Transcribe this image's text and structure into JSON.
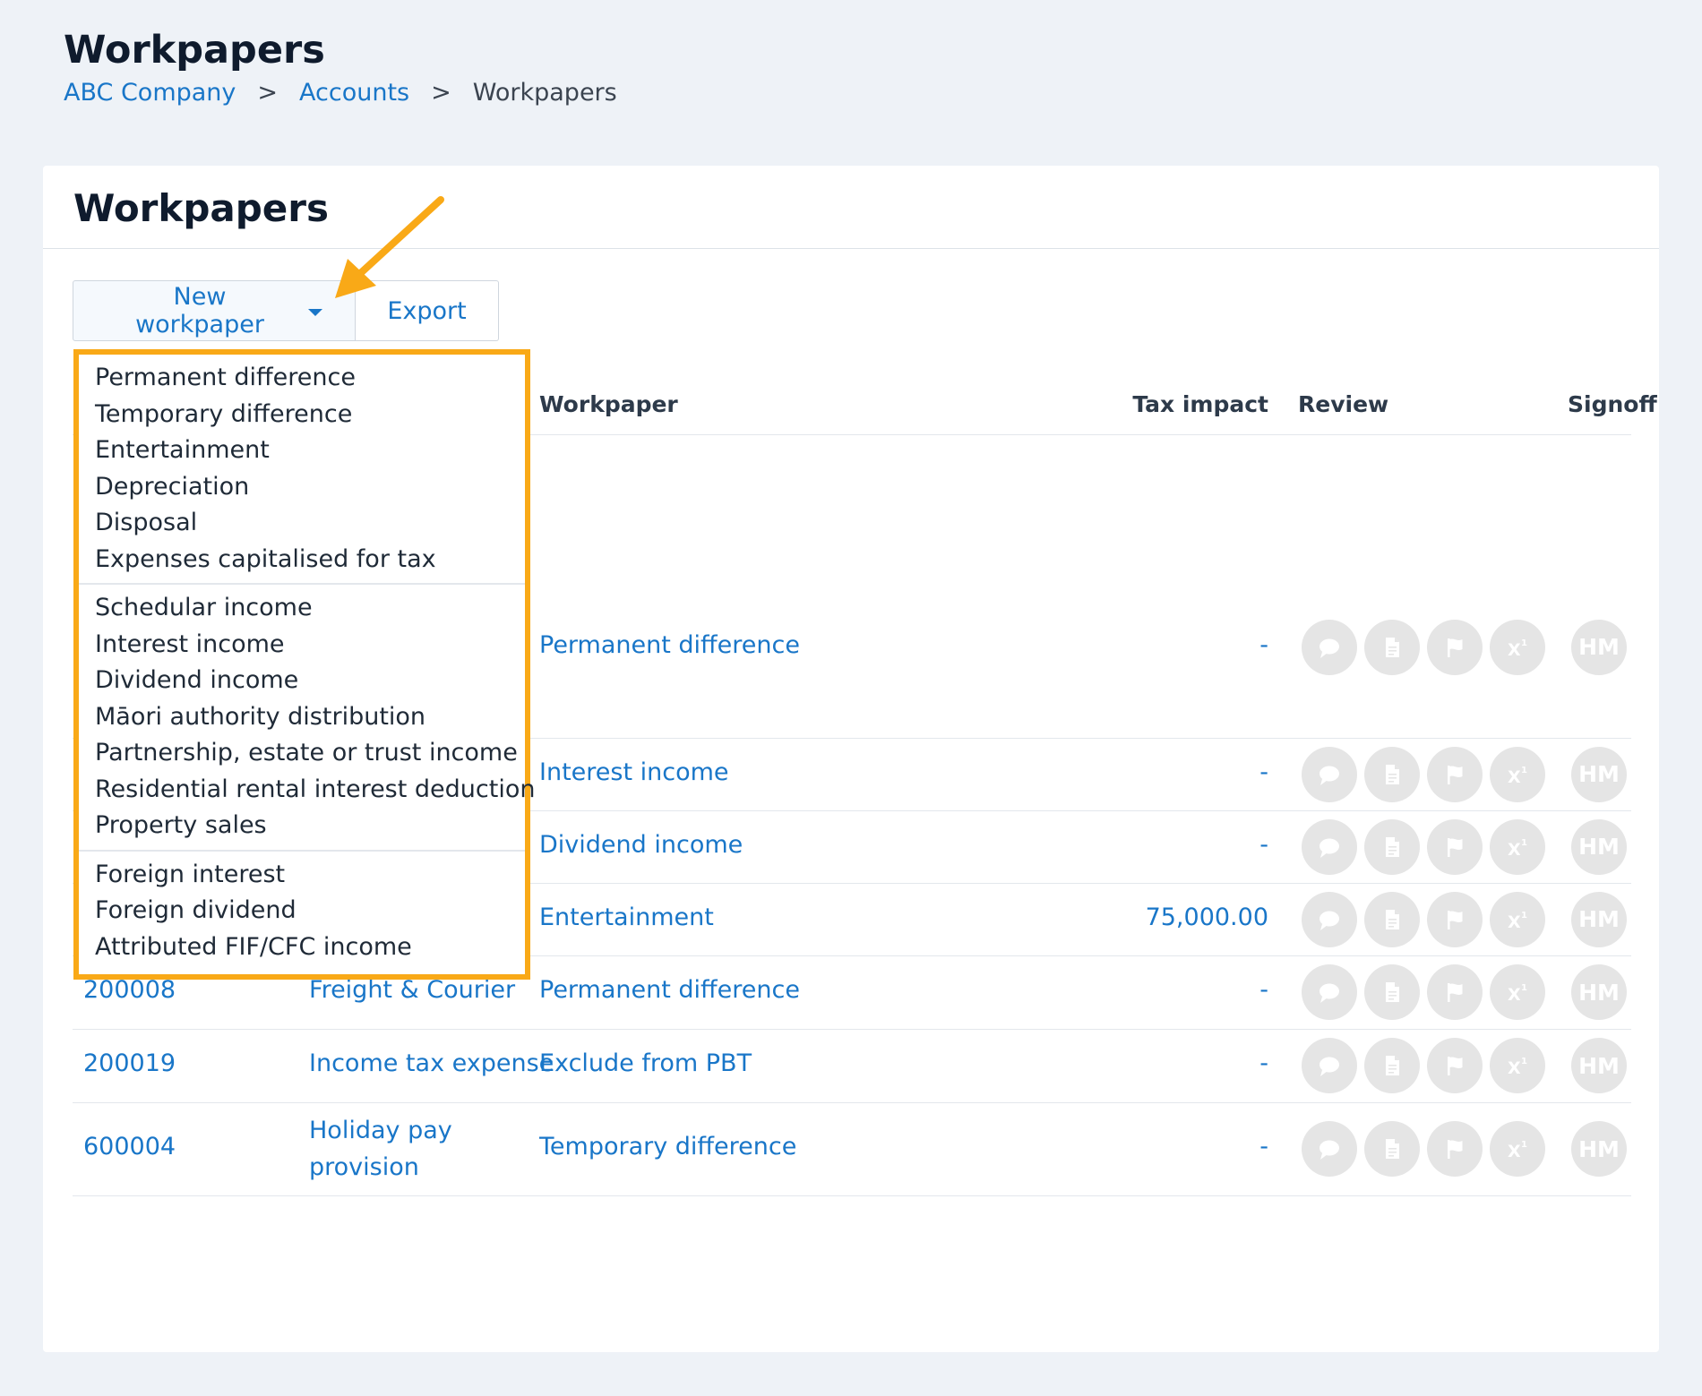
{
  "page": {
    "title": "Workpapers",
    "breadcrumb": {
      "items": [
        "ABC Company",
        "Accounts",
        "Workpapers"
      ],
      "separator": ">"
    }
  },
  "card": {
    "title": "Workpapers",
    "buttons": {
      "new_workpaper": "New workpaper",
      "export": "Export"
    }
  },
  "table": {
    "headers": {
      "workpaper": "Workpaper",
      "tax_impact": "Tax impact",
      "review": "Review",
      "signoff": "Signoff"
    },
    "rows": [
      {
        "code": "",
        "account": "",
        "workpaper": "Permanent difference",
        "tax_impact": "-",
        "signoff": "HM"
      },
      {
        "code": "",
        "account": "",
        "workpaper": "Interest income",
        "tax_impact": "-",
        "signoff": "HM"
      },
      {
        "code": "",
        "account": "",
        "workpaper": "Dividend income",
        "tax_impact": "-",
        "signoff": "HM"
      },
      {
        "code": "",
        "account": "",
        "workpaper": "Entertainment",
        "tax_impact": "75,000.00",
        "signoff": "HM"
      },
      {
        "code": "200008",
        "account": "Freight & Courier",
        "workpaper": "Permanent difference",
        "tax_impact": "-",
        "signoff": "HM"
      },
      {
        "code": "200019",
        "account": "Income tax expense",
        "workpaper": "Exclude from PBT",
        "tax_impact": "-",
        "signoff": "HM"
      },
      {
        "code": "600004",
        "account": "Holiday pay provision",
        "workpaper": "Temporary difference",
        "tax_impact": "-",
        "signoff": "HM"
      }
    ],
    "review_icons": [
      "comment-icon",
      "document-icon",
      "flag-icon",
      "superscript-icon"
    ]
  },
  "dropdown": {
    "groups": [
      [
        "Permanent difference",
        "Temporary difference",
        "Entertainment",
        "Depreciation",
        "Disposal",
        "Expenses capitalised for tax"
      ],
      [
        "Schedular income",
        "Interest income",
        "Dividend income",
        "Māori authority distribution",
        "Partnership, estate or trust income",
        "Residential rental interest deduction",
        "Property sales"
      ],
      [
        "Foreign interest",
        "Foreign dividend",
        "Attributed FIF/CFC income"
      ]
    ]
  },
  "colors": {
    "accent": "#1976c8",
    "highlight": "#f9a917",
    "icon_bg": "#e5e5e5",
    "page_bg": "#eef2f7"
  }
}
